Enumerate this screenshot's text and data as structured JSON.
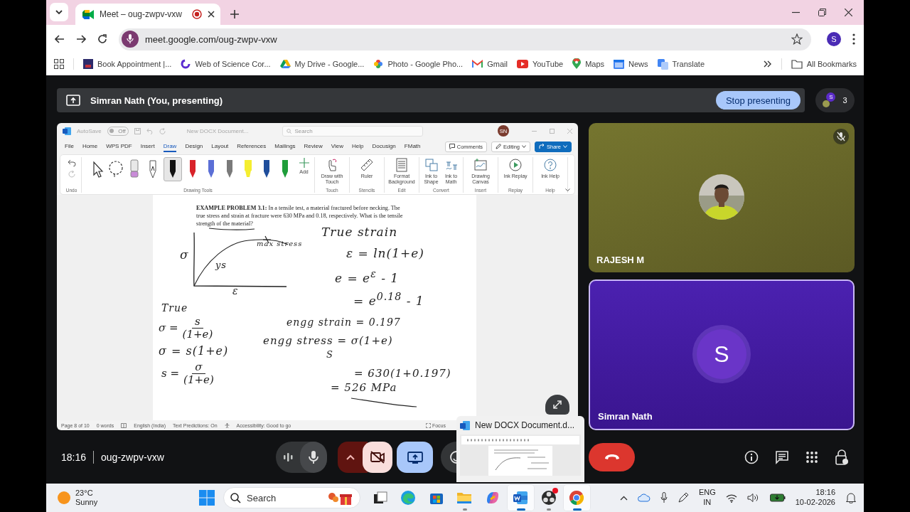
{
  "browser": {
    "tab": {
      "title": "Meet – oug-zwpv-vxw",
      "recording": true
    },
    "address": "meet.google.com/oug-zwpv-vxw",
    "profile_initial": "S",
    "bookmarks": [
      {
        "kind": "appointment",
        "label": "Book Appointment |..."
      },
      {
        "kind": "science",
        "label": "Web of Science Cor..."
      },
      {
        "kind": "drive",
        "label": "My Drive - Google..."
      },
      {
        "kind": "photos",
        "label": "Photo - Google Pho..."
      },
      {
        "kind": "gmail",
        "label": "Gmail"
      },
      {
        "kind": "youtube",
        "label": "YouTube"
      },
      {
        "kind": "maps",
        "label": "Maps"
      },
      {
        "kind": "news",
        "label": "News"
      },
      {
        "kind": "translate",
        "label": "Translate"
      }
    ],
    "all_bookmarks": "All Bookmarks"
  },
  "meet": {
    "presenter_banner": "Simran Nath (You, presenting)",
    "stop_presenting": "Stop presenting",
    "people_avatar": "S",
    "people_count": "3",
    "shared_window": {
      "autosave_label": "AutoSave",
      "autosave_state": "Off",
      "document_title": "New DOCX Document...",
      "search_placeholder": "Search",
      "user_initials": "SN",
      "ribbon_tabs": [
        {
          "label": "File",
          "selected": false
        },
        {
          "label": "Home",
          "selected": false
        },
        {
          "label": "WPS PDF",
          "selected": false
        },
        {
          "label": "Insert",
          "selected": false
        },
        {
          "label": "Draw",
          "selected": true
        },
        {
          "label": "Design",
          "selected": false
        },
        {
          "label": "Layout",
          "selected": false
        },
        {
          "label": "References",
          "selected": false
        },
        {
          "label": "Mailings",
          "selected": false
        },
        {
          "label": "Review",
          "selected": false
        },
        {
          "label": "View",
          "selected": false
        },
        {
          "label": "Help",
          "selected": false
        },
        {
          "label": "Docusign",
          "selected": false
        },
        {
          "label": "FMath",
          "selected": false
        }
      ],
      "comments": "Comments",
      "editing": "Editing",
      "share": "Share",
      "undo_group": "Undo",
      "drawing_tools": [
        {
          "kind": "select",
          "selected": false
        },
        {
          "kind": "lasso",
          "selected": false
        },
        {
          "kind": "eraser",
          "selected": false
        },
        {
          "kind": "text-pen",
          "selected": false
        },
        {
          "kind": "pen",
          "color": "#111111",
          "selected": true
        },
        {
          "kind": "pen",
          "color": "#d8232a",
          "selected": false
        },
        {
          "kind": "pen",
          "color": "#5b6fd6",
          "selected": false
        },
        {
          "kind": "pencil",
          "color": "#7a7a7a",
          "selected": false
        },
        {
          "kind": "highlighter",
          "color": "#f5ee30",
          "selected": false
        },
        {
          "kind": "pen",
          "color": "#1f4e9c",
          "selected": false
        },
        {
          "kind": "pen",
          "color": "#1f9d3a",
          "selected": false
        }
      ],
      "add_label": "Add",
      "drawing_tools_group": "Drawing Tools",
      "ribbon_groups": [
        {
          "label": "Touch",
          "buttons": [
            {
              "kind": "touch",
              "label": "Draw with Touch"
            }
          ]
        },
        {
          "label": "Stencils",
          "buttons": [
            {
              "kind": "ruler",
              "label": "Ruler"
            }
          ]
        },
        {
          "label": "Edit",
          "buttons": [
            {
              "kind": "background",
              "label": "Format Background"
            }
          ]
        },
        {
          "label": "Convert",
          "buttons": [
            {
              "kind": "shape",
              "label": "Ink to Shape"
            },
            {
              "kind": "math",
              "label": "Ink to Math"
            }
          ]
        },
        {
          "label": "Insert",
          "buttons": [
            {
              "kind": "canvas",
              "label": "Drawing Canvas"
            }
          ]
        },
        {
          "label": "Replay",
          "buttons": [
            {
              "kind": "replay",
              "label": "Ink Replay"
            }
          ]
        },
        {
          "label": "Help",
          "buttons": [
            {
              "kind": "help",
              "label": "Ink Help"
            }
          ]
        }
      ],
      "problem": "**EXAMPLE PROBLEM 3.1:** In a tensile test, a material fractured before necking. The true stress and strain at fracture were 630 MPa and 0.18, respectively. What is the tensile strength of the material?",
      "sketch_labels": [
        "σ",
        "ys",
        "max stress",
        "ε"
      ],
      "notes": [
        {
          "kind": "line",
          "text": "True strain"
        },
        {
          "kind": "line",
          "text": "ε = ln(1+e)"
        },
        {
          "kind": "line",
          "text": "e = e$^{ε}$ - 1"
        },
        {
          "kind": "line",
          "text": "= e$^{0.18}$ - 1"
        },
        {
          "kind": "line",
          "text": "engg strain = 0.197"
        },
        {
          "kind": "line",
          "text": "engg stress = σ(1+e)"
        },
        {
          "kind": "line",
          "text": "S"
        },
        {
          "kind": "line",
          "text": "= 630(1+0.197)"
        },
        {
          "kind": "line",
          "text": "= 526 MPa"
        },
        {
          "kind": "line",
          "text": "True"
        },
        {
          "kind": "fraction",
          "left": "σ =",
          "numerator": "s",
          "denominator": "(1+e)"
        },
        {
          "kind": "line",
          "text": "σ = s(1+e)"
        },
        {
          "kind": "fraction",
          "left": "s =",
          "numerator": "σ",
          "denominator": "(1+e)"
        }
      ],
      "status": [
        "Page 8 of 10",
        "0 words",
        "English (India)",
        "Text Predictions: On",
        "Accessibility: Good to go"
      ],
      "focus": "Focus"
    },
    "tiles": [
      {
        "kind": "video",
        "name": "RAJESH M",
        "muted": true,
        "speaking": false
      },
      {
        "kind": "avatar",
        "name": "Simran Nath",
        "initial": "S",
        "muted": false,
        "speaking": true
      }
    ],
    "time": "18:16",
    "meeting_code": "oug-zwpv-vxw",
    "controls": [
      {
        "kind": "audio-levels"
      },
      {
        "kind": "mic"
      },
      {
        "kind": "more-camera"
      },
      {
        "kind": "camera-off"
      },
      {
        "kind": "present"
      },
      {
        "kind": "emoji"
      }
    ],
    "side_controls": [
      {
        "kind": "info"
      },
      {
        "kind": "chat"
      },
      {
        "kind": "activities"
      },
      {
        "kind": "host-controls"
      }
    ]
  },
  "taskbar_preview": {
    "title": "New DOCX Document.d..."
  },
  "taskbar": {
    "weather": {
      "temperature": "23°C",
      "condition": "Sunny"
    },
    "search_placeholder": "Search",
    "apps": [
      {
        "kind": "task-view",
        "open": false,
        "active": false,
        "badge": false
      },
      {
        "kind": "edge",
        "open": false,
        "active": false,
        "badge": false
      },
      {
        "kind": "store",
        "open": false,
        "active": false,
        "badge": false
      },
      {
        "kind": "explorer",
        "open": true,
        "active": false,
        "badge": false
      },
      {
        "kind": "copilot",
        "open": false,
        "active": false,
        "badge": false
      },
      {
        "kind": "word",
        "open": true,
        "active": true,
        "badge": false
      },
      {
        "kind": "obs",
        "open": true,
        "active": false,
        "badge": true
      },
      {
        "kind": "chrome",
        "open": true,
        "active": true,
        "badge": false
      }
    ],
    "language": "ENG",
    "region": "IN",
    "time": "18:16",
    "date": "10-02-2026"
  }
}
